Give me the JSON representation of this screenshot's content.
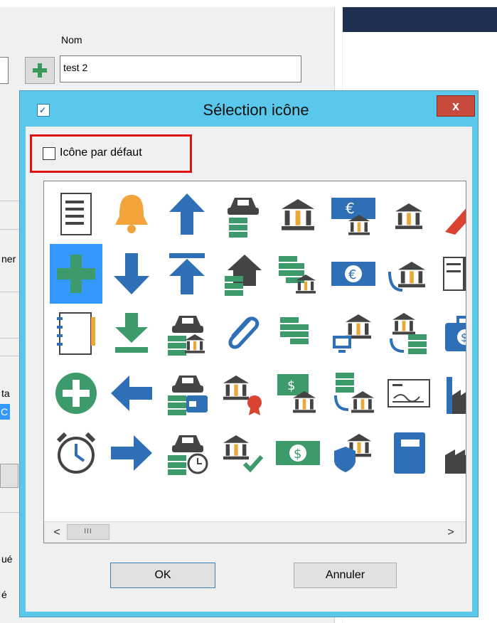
{
  "background": {
    "nom_label": "Nom",
    "nom_value": "test 2",
    "fragments": [
      "ner",
      "ta",
      "C",
      "ué",
      "é"
    ]
  },
  "dialog": {
    "title": "Sélection icône",
    "close_label": "x",
    "default_checkbox_label": "Icône par défaut",
    "default_checked": false,
    "scroll_thumb_label": "III",
    "scroll_left": "<",
    "scroll_right": ">",
    "ok_label": "OK",
    "cancel_label": "Annuler"
  },
  "icons": [
    [
      "document-icon",
      "bell-icon",
      "arrow-up-icon",
      "car-money-icon",
      "bank-icon",
      "euro-bank-icon",
      "bank-small-icon",
      "ribbon-icon"
    ],
    [
      "plus-icon",
      "arrow-down-icon",
      "arrow-top-icon",
      "house-money-icon",
      "money-bank-icon",
      "euro-banknote-icon",
      "bank-transfer-icon",
      "book-open-icon"
    ],
    [
      "notebook-icon",
      "download-icon",
      "car-bank-icon",
      "paperclip-icon",
      "money-stack-icon",
      "bank-computer-icon",
      "bank-money-transfer-icon",
      "briefcase-dollar-icon"
    ],
    [
      "plus-circle-icon",
      "arrow-left-icon",
      "car-card-icon",
      "bank-award-icon",
      "dollar-bank-icon",
      "money-bank-transfer-icon",
      "cheque-icon",
      "factory-icon"
    ],
    [
      "alarm-clock-icon",
      "arrow-right-icon",
      "car-clock-icon",
      "bank-check-icon",
      "dollar-banknote-icon",
      "shield-bank-icon",
      "book-icon",
      "factory-small-icon"
    ]
  ],
  "selected_icon": "plus-icon",
  "colors": {
    "dialog_frame": "#5ac8ea",
    "selection": "#3399ff",
    "highlight_border": "#e01010",
    "close_button": "#c74a3c"
  }
}
